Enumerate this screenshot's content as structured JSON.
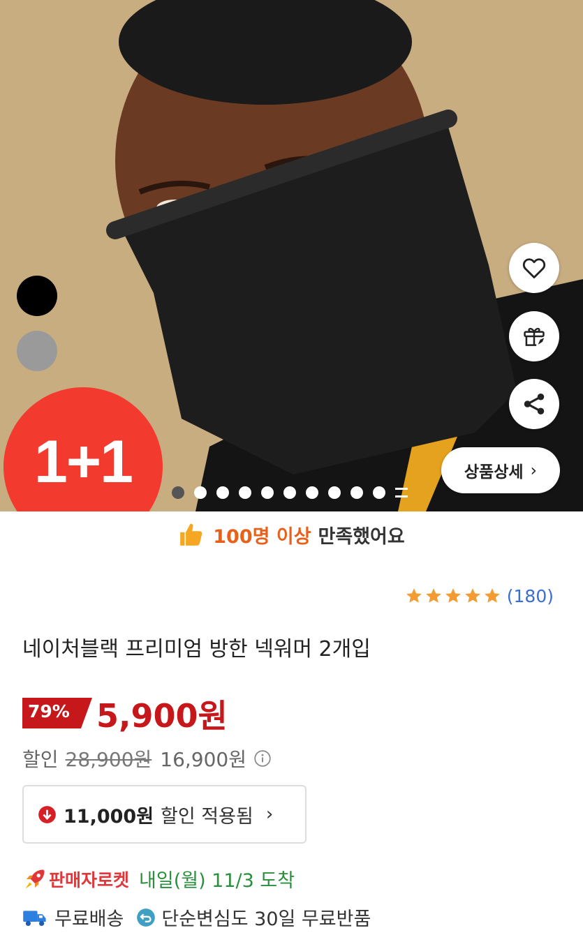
{
  "hero": {
    "badge": "1+1",
    "detail_button": "상품상세",
    "detail_chevron": "›",
    "color_swatches": [
      {
        "name": "black",
        "color": "#000000"
      },
      {
        "name": "gray",
        "color": "#9a9a9a"
      }
    ],
    "carousel": {
      "total_dots": 10,
      "active_index": 0
    },
    "action_icons": [
      "heart-icon",
      "gift-icon",
      "share-icon"
    ]
  },
  "satisfaction": {
    "icon": "thumbs-up-icon",
    "highlight": "100명 이상",
    "text": "만족했어요"
  },
  "rating": {
    "stars": 5,
    "count": "(180)"
  },
  "product": {
    "title": "네이처블랙 프리미엄 방한 넥워머 2개입"
  },
  "price": {
    "discount_rate": "79%",
    "sale_price": "5,900원",
    "discount_label": "할인",
    "original_price": "28,900원",
    "intermediate_price": "16,900원",
    "coupon_amount": "11,000원",
    "coupon_text": "할인 적용됨",
    "coupon_chevron": "›"
  },
  "delivery": {
    "rocket_label": "판매자로켓",
    "arrival": "내일(월) 11/3 도착",
    "free_shipping": "무료배송",
    "free_return": "단순변심도 30일 무료반품"
  },
  "colors": {
    "accent_red": "#c6171b",
    "badge_red": "#f23a2f",
    "orange": "#e8611a",
    "green": "#2a8f3c",
    "link_blue": "#3a6fd1",
    "hero_bg": "#c8ad80"
  }
}
